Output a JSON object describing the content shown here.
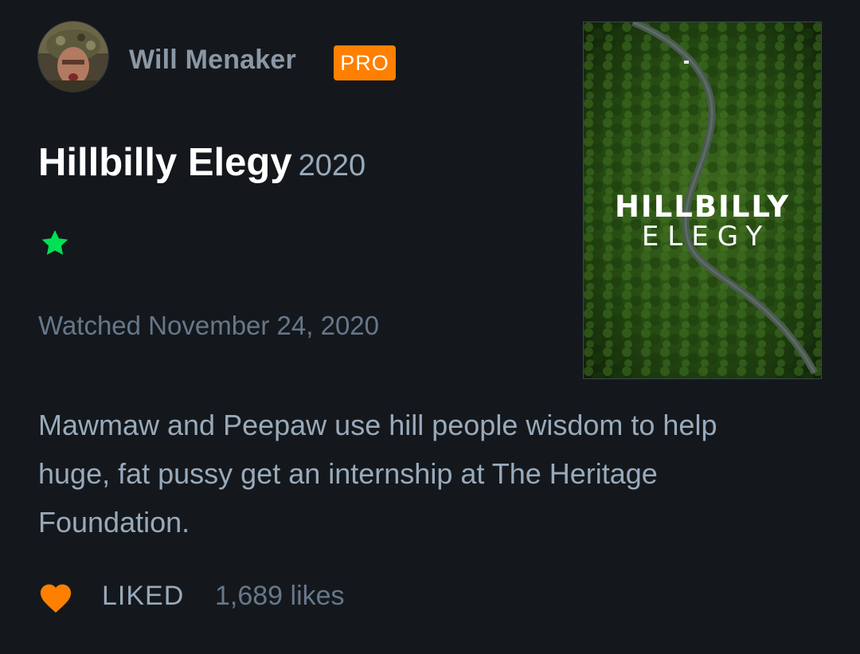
{
  "user": {
    "name": "Will Menaker",
    "badge": "PRO"
  },
  "film": {
    "title": "Hillbilly Elegy",
    "year": "2020",
    "rating_stars": 1,
    "rating_max": 5,
    "star_color": "#00e054"
  },
  "watched_date": "Watched November 24, 2020",
  "review_text": "Mawmaw and Peepaw use hill people wisdom to help huge, fat pussy get an internship at The Heritage Foundation.",
  "poster": {
    "line1": "HILLBILLY",
    "line2": "ELEGY"
  },
  "like": {
    "label": "LIKED",
    "count_text": "1,689 likes",
    "heart_color": "#ff8000"
  },
  "colors": {
    "background": "#14181c",
    "pro_badge": "#ff8000",
    "liked_heart": "#ff8000",
    "star": "#00e054"
  },
  "icons": {
    "rating": "star-icon",
    "like": "heart-icon"
  }
}
